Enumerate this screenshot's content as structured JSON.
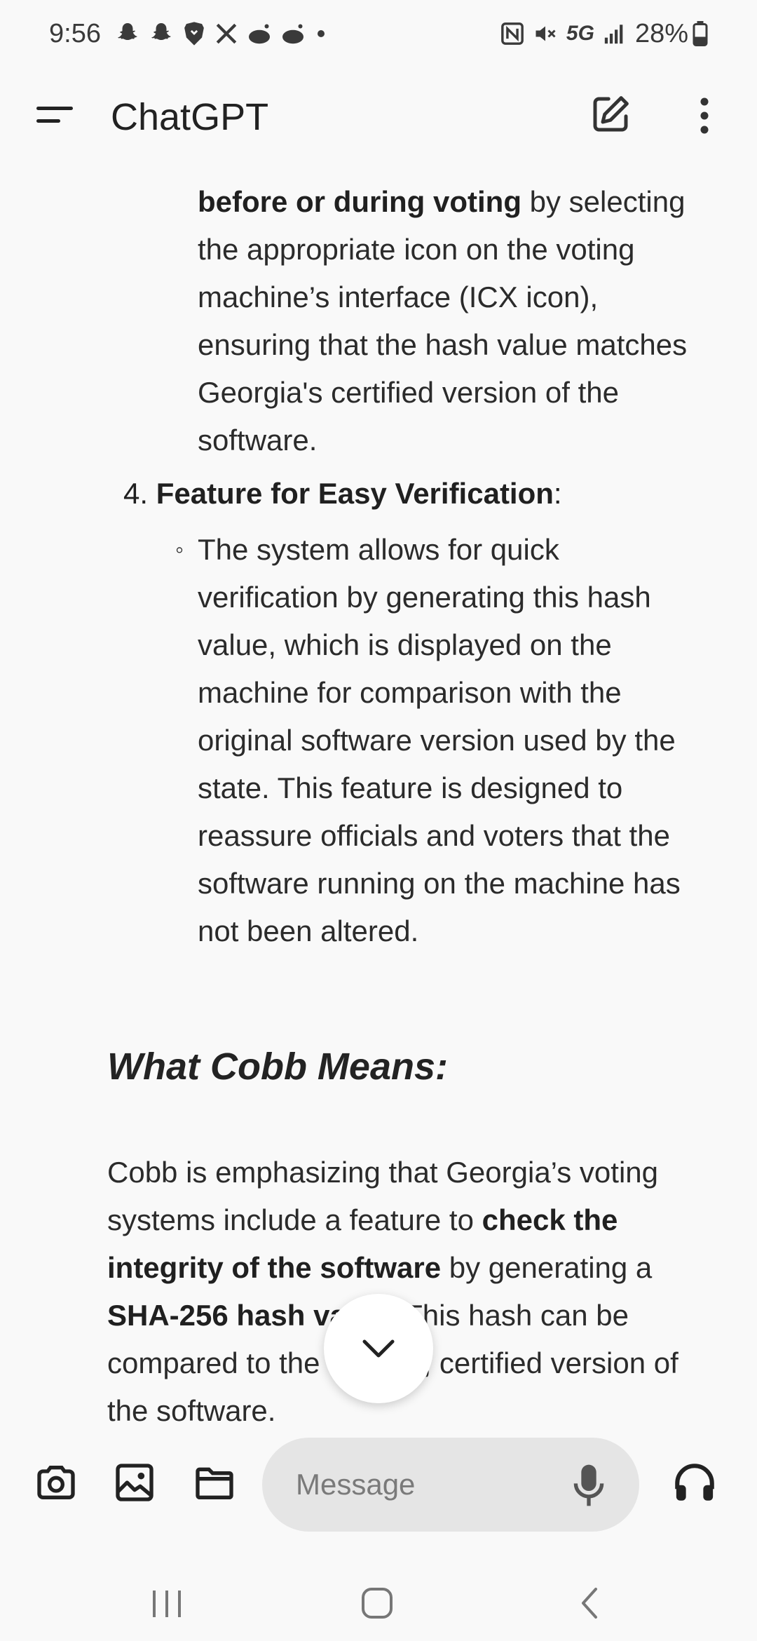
{
  "status_bar": {
    "time": "9:56",
    "network": "5G",
    "battery": "28%",
    "icons": [
      "snapchat-icon",
      "snapchat-icon",
      "brave-icon",
      "x-icon",
      "reddit-icon",
      "reddit-icon",
      "dot-icon",
      "nfc-icon",
      "mute-icon",
      "signal-icon",
      "battery-icon"
    ]
  },
  "app_bar": {
    "title": "ChatGPT"
  },
  "content": {
    "para_top": {
      "bold": "before or during voting",
      "rest": " by selecting the appropriate icon on the voting machine’s interface (ICX icon), ensuring that the hash value matches Georgia's certified version of the software."
    },
    "list_item_4": {
      "number": "4.",
      "title": "Feature for Easy Verification",
      "suffix": ":"
    },
    "bullet_text": "The system allows for quick verification by generating this hash value, which is displayed on the machine for comparison with the original software version used by the state. This feature is designed to reassure officials and voters that the software running on the machine has not been altered.",
    "heading": "What Cobb Means:",
    "cobb_para": {
      "part1": "Cobb is emphasizing that Georgia’s voting systems include a feature to ",
      "bold1": "check the integrity of the software",
      "part2": " by generating a ",
      "bold2": "SHA-256 hash value",
      "part3": ". This hash can be compared to the original, certified version of the software."
    }
  },
  "input_bar": {
    "placeholder": "Message"
  },
  "colors": {
    "background": "#f9f9f9",
    "input_bg": "#e5e5e5",
    "text": "#2b2b2b"
  }
}
